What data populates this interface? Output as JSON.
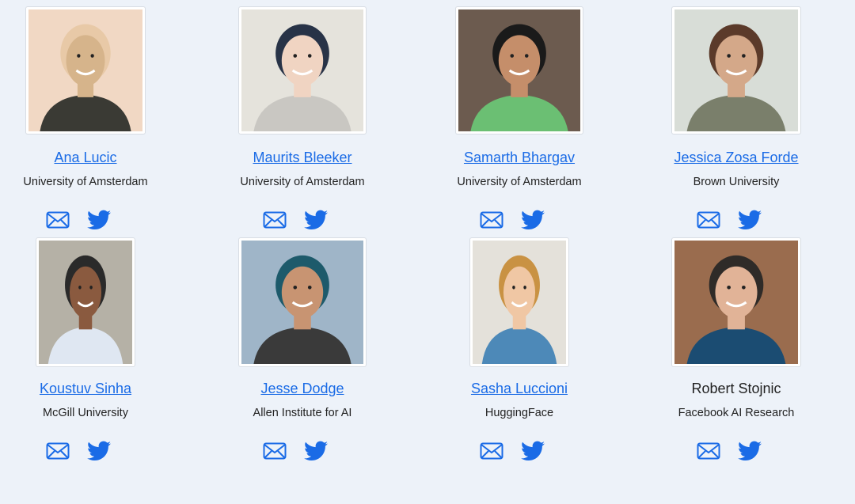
{
  "people": [
    {
      "name": "Ana Lucic",
      "affiliation": "University of Amsterdam",
      "linked": true,
      "icons": [
        "mail-icon",
        "twitter-icon"
      ]
    },
    {
      "name": "Maurits Bleeker",
      "affiliation": "University of Amsterdam",
      "linked": true,
      "icons": [
        "mail-icon",
        "twitter-icon"
      ]
    },
    {
      "name": "Samarth Bhargav",
      "affiliation": "University of Amsterdam",
      "linked": true,
      "icons": [
        "mail-icon",
        "twitter-icon"
      ]
    },
    {
      "name": "Jessica Zosa Forde",
      "affiliation": "Brown University",
      "linked": true,
      "icons": [
        "mail-icon",
        "twitter-icon"
      ]
    },
    {
      "name": "Koustuv Sinha",
      "affiliation": "McGill University",
      "linked": true,
      "icons": [
        "mail-icon",
        "twitter-icon"
      ]
    },
    {
      "name": "Jesse Dodge",
      "affiliation": "Allen Institute for AI",
      "linked": true,
      "icons": [
        "mail-icon",
        "twitter-icon"
      ]
    },
    {
      "name": "Sasha Luccioni",
      "affiliation": "HuggingFace",
      "linked": true,
      "icons": [
        "mail-icon",
        "twitter-icon"
      ]
    },
    {
      "name": "Robert Stojnic",
      "affiliation": "Facebook AI Research",
      "linked": false,
      "icons": [
        "mail-icon",
        "twitter-icon"
      ]
    }
  ],
  "colors": {
    "link": "#1a6be6",
    "icon": "#1a6be6",
    "background": "#edf2f9"
  }
}
